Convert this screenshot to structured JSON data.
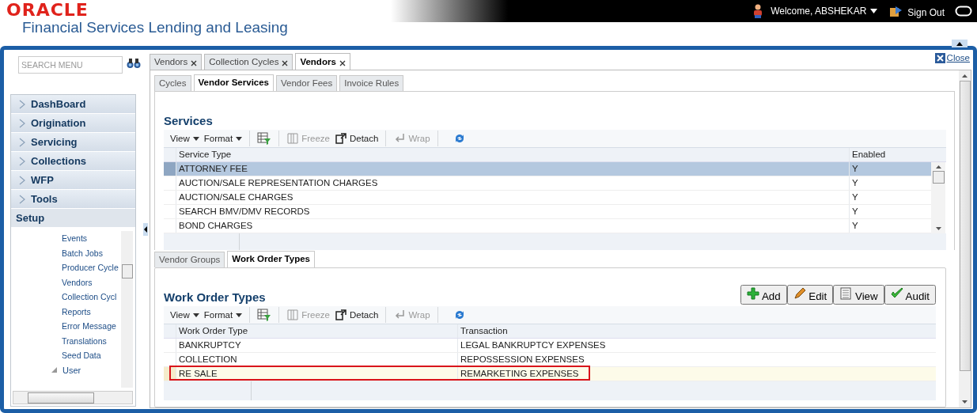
{
  "header": {
    "logo": "ORACLE",
    "product": "Financial Services Lending and Leasing",
    "welcome": "Welcome, ABSHEKAR",
    "sign_out": "Sign Out"
  },
  "sidebar": {
    "search": {
      "placeholder": "SEARCH MENU"
    },
    "nav": [
      {
        "label": "DashBoard",
        "expanded": false
      },
      {
        "label": "Origination",
        "expanded": false
      },
      {
        "label": "Servicing",
        "expanded": false
      },
      {
        "label": "Collections",
        "expanded": false
      },
      {
        "label": "WFP",
        "expanded": false
      },
      {
        "label": "Tools",
        "expanded": false
      },
      {
        "label": "Setup",
        "expanded": true
      }
    ],
    "tree": [
      {
        "children": [
          {
            "label": "Events"
          },
          {
            "label": "Batch Jobs"
          },
          {
            "label": "Producer Cycle"
          },
          {
            "label": "Vendors"
          },
          {
            "label": "Collection Cycl"
          },
          {
            "label": "Reports"
          },
          {
            "label": "Error Message"
          },
          {
            "label": "Translations"
          },
          {
            "label": "Seed Data"
          }
        ]
      },
      {
        "label": "User",
        "expanded": true
      }
    ]
  },
  "doc_tabs": [
    {
      "label": "Vendors",
      "selected": false
    },
    {
      "label": "Collection Cycles",
      "selected": false
    },
    {
      "label": "Vendors",
      "selected": true
    }
  ],
  "close": "Close",
  "sub_tabs": [
    {
      "label": "Cycles",
      "selected": false
    },
    {
      "label": "Vendor Services",
      "selected": true
    },
    {
      "label": "Vendor Fees",
      "selected": false
    },
    {
      "label": "Invoice Rules",
      "selected": false
    }
  ],
  "services": {
    "title": "Services",
    "toolbar": [
      {
        "kind": "menu",
        "label": "View"
      },
      {
        "kind": "menu",
        "label": "Format"
      },
      {
        "kind": "filter"
      },
      {
        "kind": "freeze",
        "label": "Freeze",
        "disabled": true
      },
      {
        "kind": "detach",
        "label": "Detach",
        "disabled": false
      },
      {
        "kind": "wrap",
        "label": "Wrap",
        "disabled": true
      },
      {
        "kind": "refresh"
      }
    ],
    "columns": [
      "Service Type",
      "Enabled"
    ],
    "rows": [
      {
        "cells": [
          "ATTORNEY FEE",
          "Y"
        ],
        "selected": true
      },
      {
        "cells": [
          "AUCTION/SALE REPRESENTATION CHARGES",
          "Y"
        ],
        "selected": false
      },
      {
        "cells": [
          "AUCTION/SALE CHARGES",
          "Y"
        ],
        "selected": false
      },
      {
        "cells": [
          "SEARCH BMV/DMV RECORDS",
          "Y"
        ],
        "selected": false
      },
      {
        "cells": [
          "BOND CHARGES",
          "Y"
        ],
        "selected": false
      }
    ]
  },
  "inner_tabs": [
    {
      "label": "Vendor Groups",
      "selected": false
    },
    {
      "label": "Work Order Types",
      "selected": true
    }
  ],
  "work_order_types": {
    "title": "Work Order Types",
    "buttons": [
      {
        "kind": "add",
        "label": "Add"
      },
      {
        "kind": "edit",
        "label": "Edit"
      },
      {
        "kind": "view",
        "label": "View"
      },
      {
        "kind": "audit",
        "label": "Audit"
      }
    ],
    "toolbar": [
      {
        "kind": "menu",
        "label": "View"
      },
      {
        "kind": "menu",
        "label": "Format"
      },
      {
        "kind": "filter"
      },
      {
        "kind": "freeze",
        "label": "Freeze",
        "disabled": true
      },
      {
        "kind": "detach",
        "label": "Detach",
        "disabled": false
      },
      {
        "kind": "wrap",
        "label": "Wrap",
        "disabled": true
      },
      {
        "kind": "refresh"
      }
    ],
    "columns": [
      "Work Order Type",
      "Transaction"
    ],
    "rows": [
      {
        "cells": [
          "BANKRUPTCY",
          "LEGAL BANKRUPTCY EXPENSES"
        ],
        "selected": false,
        "highlighted": false
      },
      {
        "cells": [
          "COLLECTION",
          "REPOSSESSION EXPENSES"
        ],
        "selected": false,
        "highlighted": false
      },
      {
        "cells": [
          "RE SALE",
          "REMARKETING EXPENSES"
        ],
        "selected": true,
        "highlighted": true
      }
    ]
  }
}
